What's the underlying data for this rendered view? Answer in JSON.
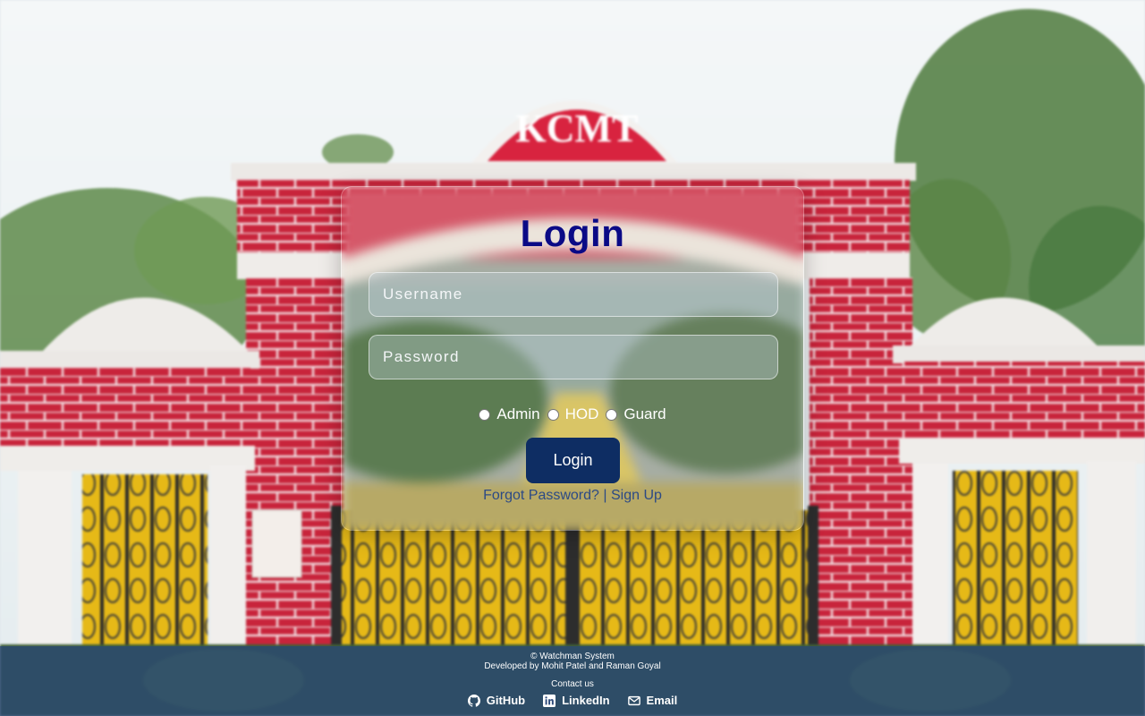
{
  "login": {
    "title": "Login",
    "username_placeholder": "Username",
    "password_placeholder": "Password",
    "roles": [
      "Admin",
      "HOD",
      "Guard"
    ],
    "button_label": "Login",
    "forgot_password": "Forgot Password?",
    "separator": "|",
    "sign_up": "Sign Up"
  },
  "background": {
    "sign_text": "KCMT"
  },
  "footer": {
    "copyright": "© Watchman System",
    "developed_by": "Developed by Mohit Patel and Raman Goyal",
    "contact": "Contact us",
    "links": [
      {
        "label": "GitHub",
        "icon": "github-icon"
      },
      {
        "label": "LinkedIn",
        "icon": "linkedin-icon"
      },
      {
        "label": "Email",
        "icon": "envelope-icon"
      }
    ]
  },
  "colors": {
    "title": "#0b0a86",
    "button": "#0e2d63",
    "link": "#2c4a85",
    "brick": "#c8243b",
    "gate": "#e2b814"
  }
}
